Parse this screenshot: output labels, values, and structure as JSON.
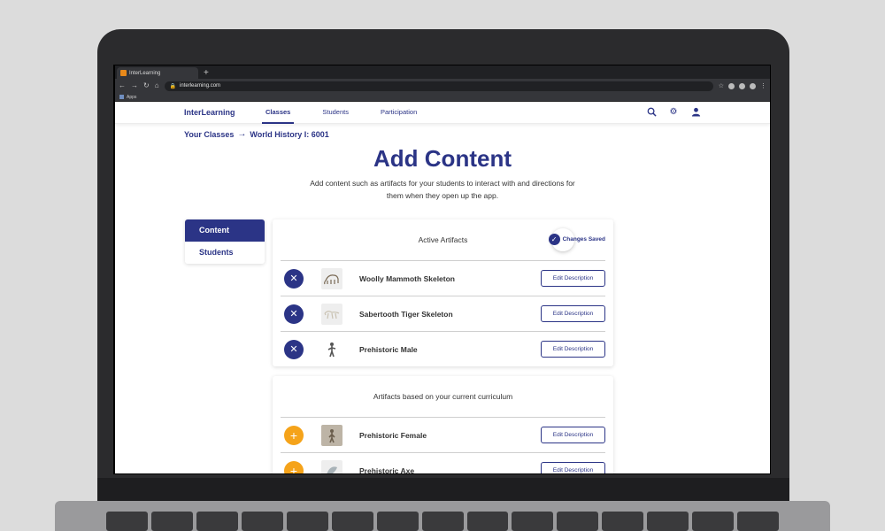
{
  "browser": {
    "tab_title": "InterLearning",
    "new_tab_glyph": "+",
    "url": "interlearning.com",
    "bookmark_label": "Apps"
  },
  "app": {
    "logo": "InterLearning",
    "nav": [
      {
        "label": "Classes",
        "active": true
      },
      {
        "label": "Students",
        "active": false
      },
      {
        "label": "Participation",
        "active": false
      }
    ],
    "header_icons": [
      "search-icon",
      "gear-icon",
      "user-icon"
    ]
  },
  "breadcrumb": {
    "parent": "Your Classes",
    "current": "World History I: 6001"
  },
  "page": {
    "title": "Add Content",
    "subtitle": "Add content such as artifacts for your students to interact with and directions for them when they open up the app."
  },
  "sidebar": {
    "items": [
      {
        "label": "Content",
        "active": true
      },
      {
        "label": "Students",
        "active": false
      }
    ]
  },
  "active_artifacts": {
    "title": "Active Artifacts",
    "status": "Changes Saved",
    "items": [
      {
        "name": "Woolly Mammoth Skeleton",
        "action": "Edit Description"
      },
      {
        "name": "Sabertooth Tiger Skeleton",
        "action": "Edit Description"
      },
      {
        "name": "Prehistoric Male",
        "action": "Edit Description"
      }
    ]
  },
  "curriculum_artifacts": {
    "title": "Artifacts based on your current curriculum",
    "items": [
      {
        "name": "Prehistoric Female",
        "action": "Edit Description"
      },
      {
        "name": "Prehistoric Axe",
        "action": "Edit Description"
      }
    ]
  },
  "colors": {
    "brand": "#2b3486",
    "accent_add": "#f5a31a"
  }
}
